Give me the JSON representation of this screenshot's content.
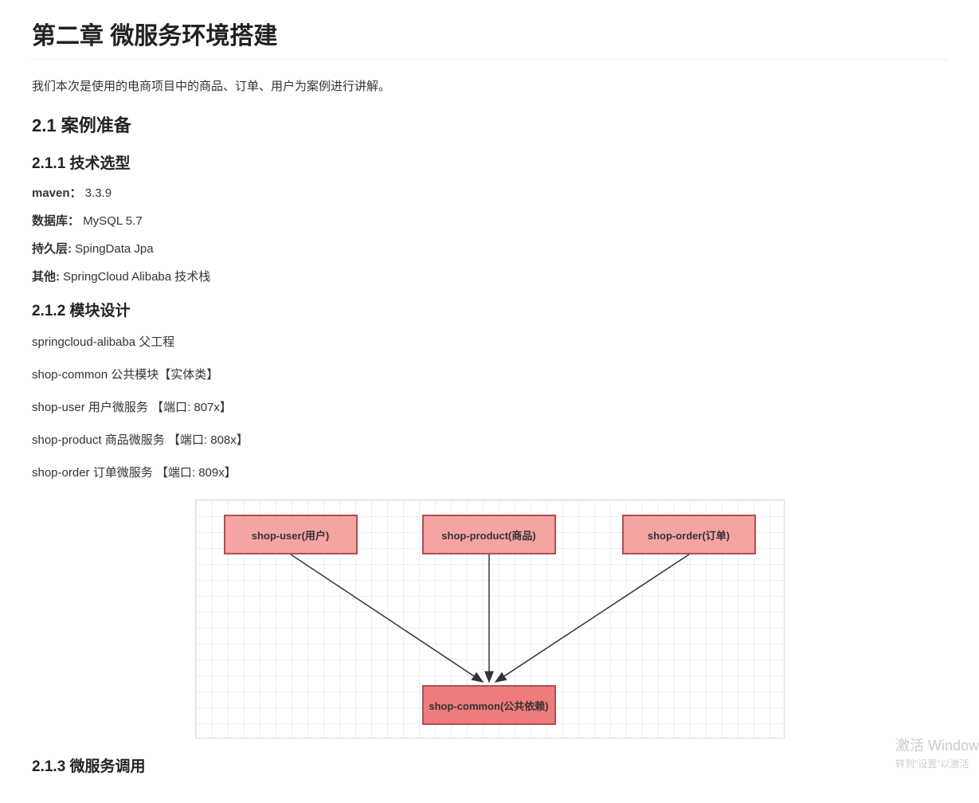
{
  "title": "第二章 微服务环境搭建",
  "intro": "我们本次是使用的电商项目中的商品、订单、用户为案例进行讲解。",
  "s21": "2.1 案例准备",
  "s211": "2.1.1 技术选型",
  "tech": {
    "maven_label": "maven：",
    "maven_value": "3.3.9",
    "db_label": "数据库：",
    "db_value": "MySQL 5.7",
    "persist_label": "持久层:",
    "persist_value": "SpingData Jpa",
    "other_label": "其他:",
    "other_value": "SpringCloud Alibaba 技术栈"
  },
  "s212": "2.1.2 模块设计",
  "modules": {
    "m1": "springcloud-alibaba 父工程",
    "m2": "shop-common 公共模块【实体类】",
    "m3": "shop-user 用户微服务 【端口: 807x】",
    "m4": "shop-product 商品微服务 【端口: 808x】",
    "m5": "shop-order 订单微服务 【端口: 809x】"
  },
  "diagram": {
    "user": "shop-user(用户)",
    "product": "shop-product(商品)",
    "order": "shop-order(订单)",
    "common": "shop-common(公共依赖)"
  },
  "s213": "2.1.3 微服务调用",
  "watermark": {
    "line1": "激活 Window",
    "line2": "转到\"设置\"以激活"
  }
}
